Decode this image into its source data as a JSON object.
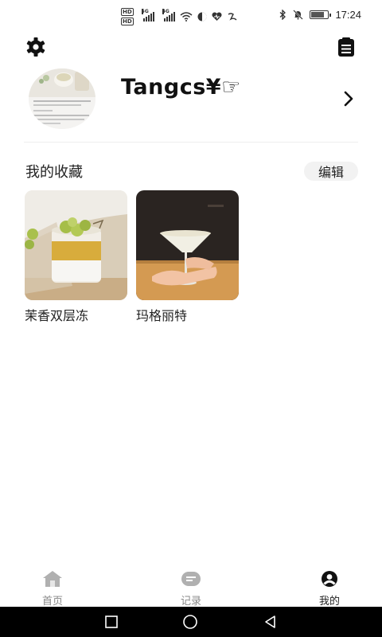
{
  "status_bar": {
    "hd_labels": [
      "HD",
      "HD"
    ],
    "signal_labels": [
      "5G",
      "4G"
    ],
    "time": "17:24",
    "icons": [
      "hd-icon",
      "signal-icon",
      "wifi-icon",
      "vpn-icon",
      "health-icon",
      "chat-icon",
      "bluetooth-icon",
      "mute-icon",
      "battery-icon"
    ]
  },
  "header": {
    "settings_icon": "gear-icon",
    "notes_icon": "clipboard-icon"
  },
  "profile": {
    "username": "Tangcs¥☞",
    "chevron_icon": "chevron-right-icon"
  },
  "favorites": {
    "title": "我的收藏",
    "edit_label": "编辑",
    "items": [
      {
        "name": "茉香双层冻"
      },
      {
        "name": "玛格丽特"
      }
    ]
  },
  "tabs": [
    {
      "label": "首页",
      "icon": "home-icon",
      "active": false
    },
    {
      "label": "记录",
      "icon": "record-icon",
      "active": false
    },
    {
      "label": "我的",
      "icon": "user-icon",
      "active": true
    }
  ],
  "colors": {
    "accent_dark": "#111111",
    "tab_inactive": "#9a9a9a",
    "nav_bar": "#000000"
  }
}
